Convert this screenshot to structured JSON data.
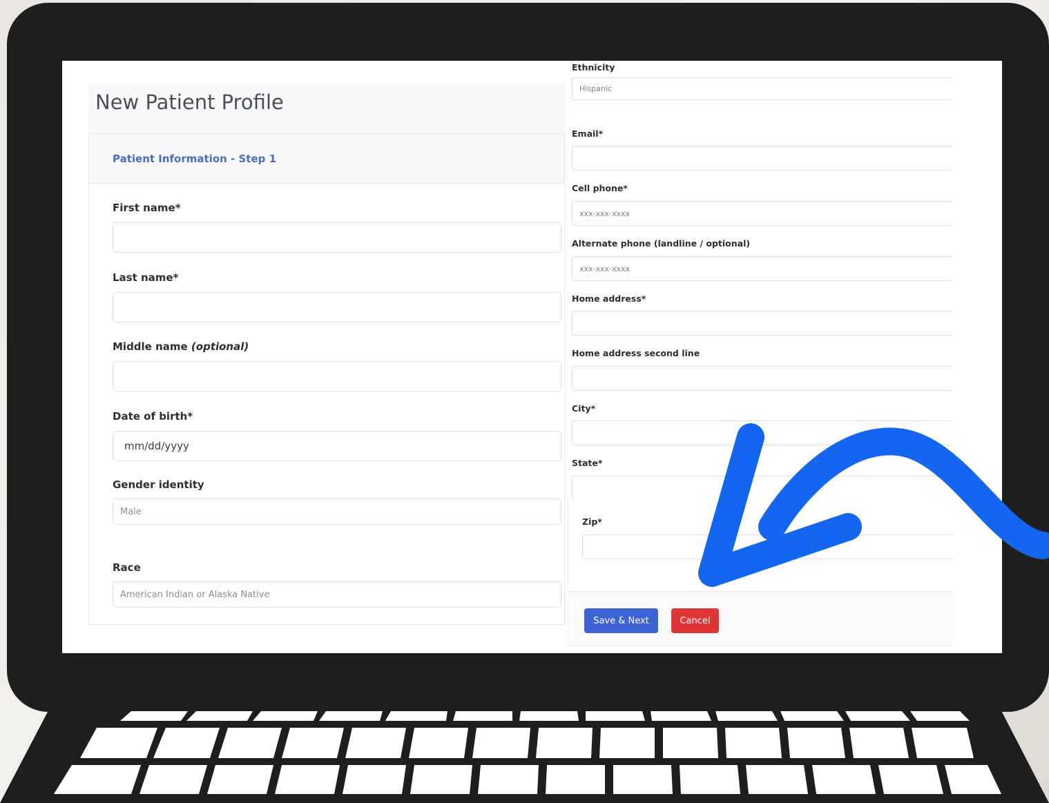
{
  "page": {
    "title": "New Patient Profile",
    "step_title": "Patient Information - Step 1"
  },
  "left_form": {
    "first_name": {
      "label": "First name*",
      "value": ""
    },
    "last_name": {
      "label": "Last name*",
      "value": ""
    },
    "middle_name": {
      "label": "Middle name",
      "label_optional": "(optional)",
      "value": ""
    },
    "date_of_birth": {
      "label": "Date of birth*",
      "placeholder": "mm/dd/yyyy"
    },
    "gender_identity": {
      "label": "Gender identity",
      "value": "Male"
    },
    "race": {
      "label": "Race",
      "value": "American Indian or Alaska Native"
    }
  },
  "right_form": {
    "ethnicity": {
      "label": "Ethnicity",
      "value": "Hispanic"
    },
    "email": {
      "label": "Email*",
      "value": ""
    },
    "cell_phone": {
      "label": "Cell phone*",
      "placeholder": "xxx-xxx-xxxx"
    },
    "alt_phone": {
      "label": "Alternate phone (landline / optional)",
      "placeholder": "xxx-xxx-xxxx"
    },
    "home_address": {
      "label": "Home address*",
      "value": ""
    },
    "home_address_2": {
      "label": "Home address second line",
      "value": ""
    },
    "city": {
      "label": "City*",
      "value": ""
    },
    "state": {
      "label": "State*",
      "value": ""
    },
    "zip": {
      "label": "Zip*",
      "value": ""
    }
  },
  "buttons": {
    "save_next": "Save & Next",
    "cancel": "Cancel"
  },
  "colors": {
    "bezel": "#1e1e1e",
    "primary": "#3e63d5",
    "danger": "#e03535",
    "arrow": "#1466f0",
    "step_title": "#4a6dbd"
  },
  "decorations": {
    "arrow_icon": "curved-arrow-icon",
    "device": "laptop-frame"
  }
}
